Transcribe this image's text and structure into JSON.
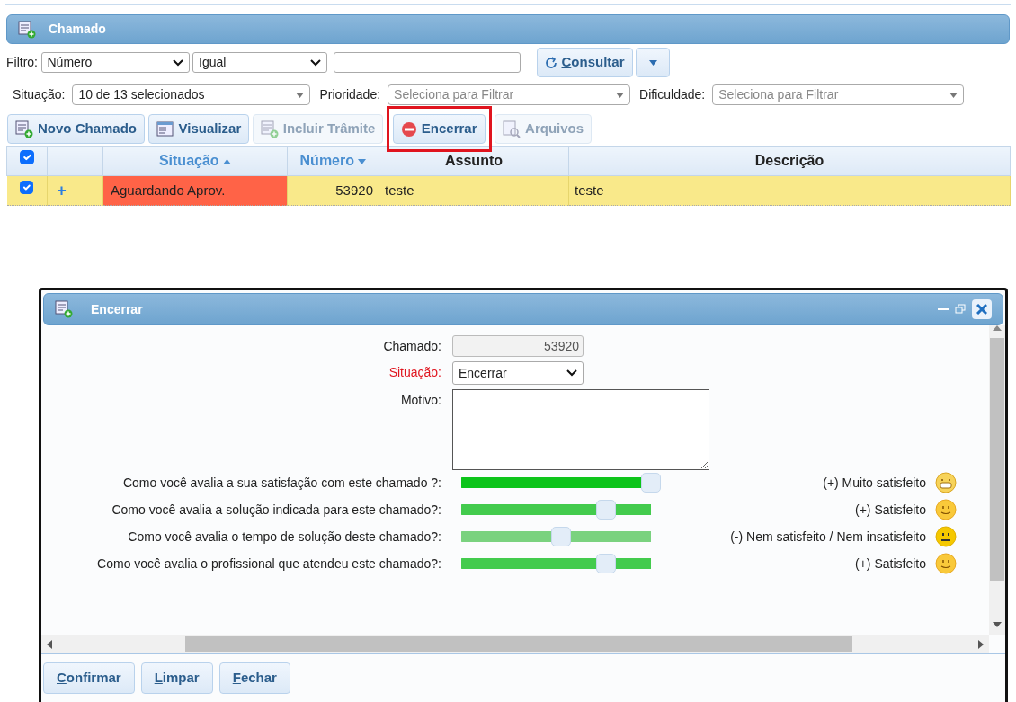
{
  "panel": {
    "title": "Chamado"
  },
  "filter": {
    "label": "Filtro:",
    "field": "Número",
    "operator": "Igual",
    "search_button": {
      "label": "Consultar",
      "mnemonic": true
    }
  },
  "filters": [
    {
      "label": "Situação:",
      "value": "10 de 13 selecionados"
    },
    {
      "label": "Prioridade:",
      "placeholder": "Seleciona para Filtrar"
    },
    {
      "label": "Dificuldade:",
      "placeholder": "Seleciona para Filtrar"
    }
  ],
  "toolbar": [
    {
      "label": "Novo Chamado",
      "kind": "new",
      "disabled": false,
      "highlighted": false
    },
    {
      "label": "Visualizar",
      "kind": "view",
      "disabled": false,
      "highlighted": false
    },
    {
      "label": "Incluir Trâmite",
      "kind": "new",
      "disabled": true,
      "highlighted": false
    },
    {
      "label": "Encerrar",
      "kind": "stop",
      "disabled": false,
      "highlighted": true
    },
    {
      "label": "Arquivos",
      "kind": "files",
      "disabled": true,
      "highlighted": false
    }
  ],
  "table": {
    "all_checked": true,
    "columns": [
      {
        "label": "Situação",
        "sorted": true,
        "ascending": true
      },
      {
        "label": "Número",
        "sorted": true,
        "ascending": false
      },
      {
        "label": "Assunto",
        "sorted": false
      },
      {
        "label": "Descrição",
        "sorted": false
      }
    ],
    "rows": [
      {
        "checked": true,
        "expand": "+",
        "situacao": "Aguardando Aprov.",
        "color": "#ff6347",
        "numero": "53920",
        "assunto": "teste",
        "descricao": "teste"
      }
    ]
  },
  "dialog": {
    "title": "Encerrar",
    "fields": [
      {
        "label": "Chamado:",
        "kind": "text",
        "value": "53920",
        "disabled": true,
        "required": false
      },
      {
        "label": "Situação:",
        "kind": "select",
        "value": "Encerrar",
        "disabled": false,
        "required": true
      },
      {
        "label": "Motivo:",
        "kind": "textarea",
        "disabled": false,
        "required": false
      }
    ],
    "ratings": [
      {
        "question": "Como você avalia a sua satisfação com este chamado ?:",
        "level": 1,
        "answer": "(+) Muito satisfeito",
        "kind": "grin"
      },
      {
        "question": "Como você avalia a solução indicada para este chamado?:",
        "level": 0.75,
        "answer": "(+) Satisfeito",
        "kind": "smile"
      },
      {
        "question": "Como você avalia o tempo de solução deste chamado?:",
        "level": 0.5,
        "answer": "(-) Nem satisfeito / Nem insatisfeito",
        "kind": "neutral"
      },
      {
        "question": "Como você avalia o profissional que atendeu este chamado?:",
        "level": 0.75,
        "answer": "(+) Satisfeito",
        "kind": "smile"
      }
    ],
    "buttons": [
      {
        "label": "Confirmar",
        "mnemonic": true
      },
      {
        "label": "Limpar",
        "mnemonic": true
      },
      {
        "label": "Fechar",
        "mnemonic": true
      }
    ]
  }
}
